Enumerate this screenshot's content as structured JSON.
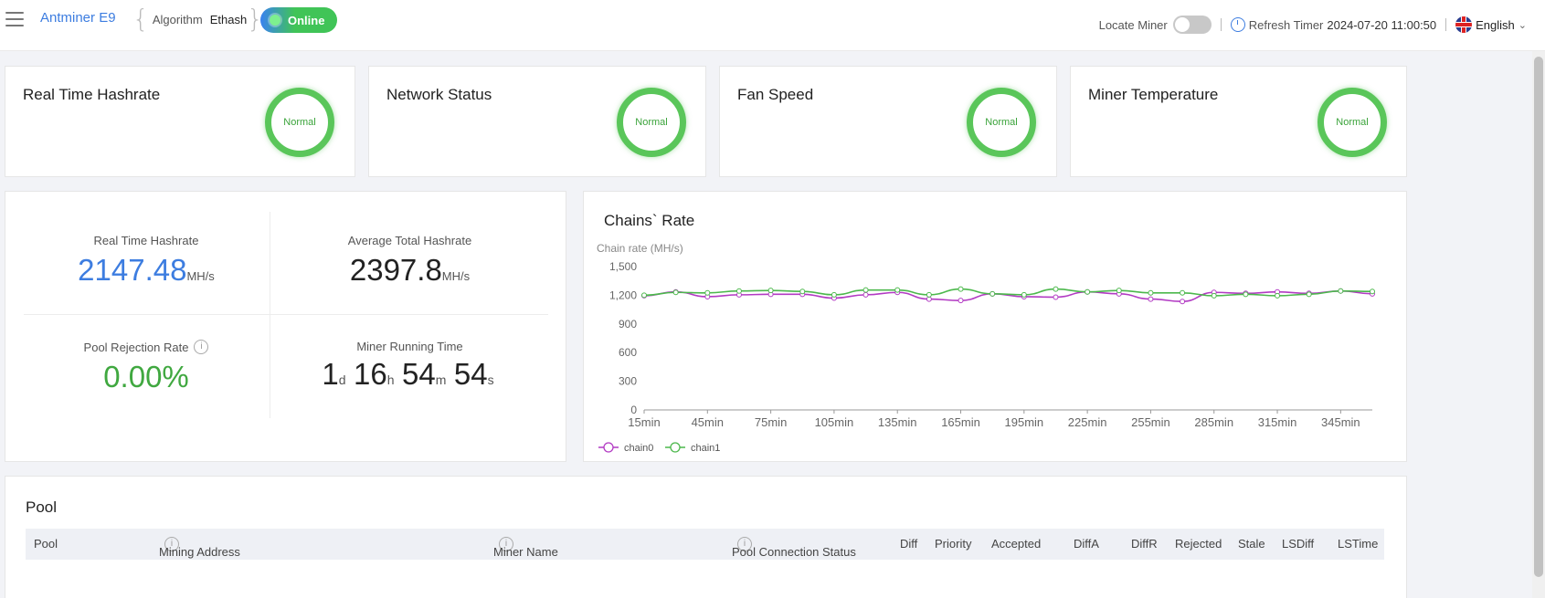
{
  "header": {
    "model": "Antminer E9",
    "algorithm_label": "Algorithm",
    "algorithm_value": "Ethash",
    "status": "Online",
    "locate_label": "Locate Miner",
    "refresh_label": "Refresh Timer",
    "refresh_value": "2024-07-20 11:00:50",
    "language": "English"
  },
  "status_cards": [
    {
      "title": "Real Time Hashrate",
      "state": "Normal"
    },
    {
      "title": "Network Status",
      "state": "Normal"
    },
    {
      "title": "Fan Speed",
      "state": "Normal"
    },
    {
      "title": "Miner Temperature",
      "state": "Normal"
    }
  ],
  "stats": {
    "realtime_label": "Real Time Hashrate",
    "realtime_value": "2147.48",
    "realtime_unit": "MH/s",
    "average_label": "Average Total Hashrate",
    "average_value": "2397.8",
    "average_unit": "MH/s",
    "rejection_label": "Pool Rejection Rate",
    "rejection_value": "0.00%",
    "runtime_label": "Miner Running Time",
    "runtime": {
      "d": "1",
      "h": "16",
      "m": "54",
      "s": "54"
    },
    "runtime_units": {
      "d": "d",
      "h": "h",
      "m": "m",
      "s": "s"
    }
  },
  "colors": {
    "accent": "#3d7de0",
    "ok_green": "#40a840",
    "chain0": "#b23ac3",
    "chain1": "#4cb84c"
  },
  "chart_data": {
    "type": "line",
    "title": "Chains` Rate",
    "ylabel": "Chain rate (MH/s)",
    "ylim": [
      0,
      1500
    ],
    "yticks": [
      0,
      300,
      600,
      900,
      1200,
      1500
    ],
    "xticks": [
      "15min",
      "45min",
      "75min",
      "105min",
      "135min",
      "165min",
      "195min",
      "225min",
      "255min",
      "285min",
      "315min",
      "345min"
    ],
    "x": [
      15,
      30,
      45,
      60,
      75,
      90,
      105,
      120,
      135,
      150,
      165,
      180,
      195,
      210,
      225,
      240,
      255,
      270,
      285,
      300,
      315,
      330,
      345,
      360
    ],
    "series": [
      {
        "name": "chain0",
        "values": [
          1195,
          1235,
          1185,
          1205,
          1210,
          1210,
          1170,
          1205,
          1230,
          1160,
          1145,
          1215,
          1185,
          1180,
          1235,
          1215,
          1160,
          1135,
          1230,
          1220,
          1235,
          1220,
          1245,
          1215
        ]
      },
      {
        "name": "chain1",
        "values": [
          1200,
          1230,
          1225,
          1245,
          1250,
          1240,
          1205,
          1255,
          1255,
          1205,
          1265,
          1215,
          1205,
          1265,
          1235,
          1250,
          1225,
          1225,
          1195,
          1210,
          1195,
          1210,
          1245,
          1240
        ]
      }
    ],
    "legend": "bottom-left",
    "grid": false
  },
  "pool": {
    "title": "Pool",
    "columns": [
      "Pool",
      "Mining Address",
      "Miner Name",
      "Pool Connection Status",
      "Diff",
      "Priority",
      "Accepted",
      "DiffA",
      "DiffR",
      "Rejected",
      "Stale",
      "LSDiff",
      "LSTime"
    ]
  }
}
